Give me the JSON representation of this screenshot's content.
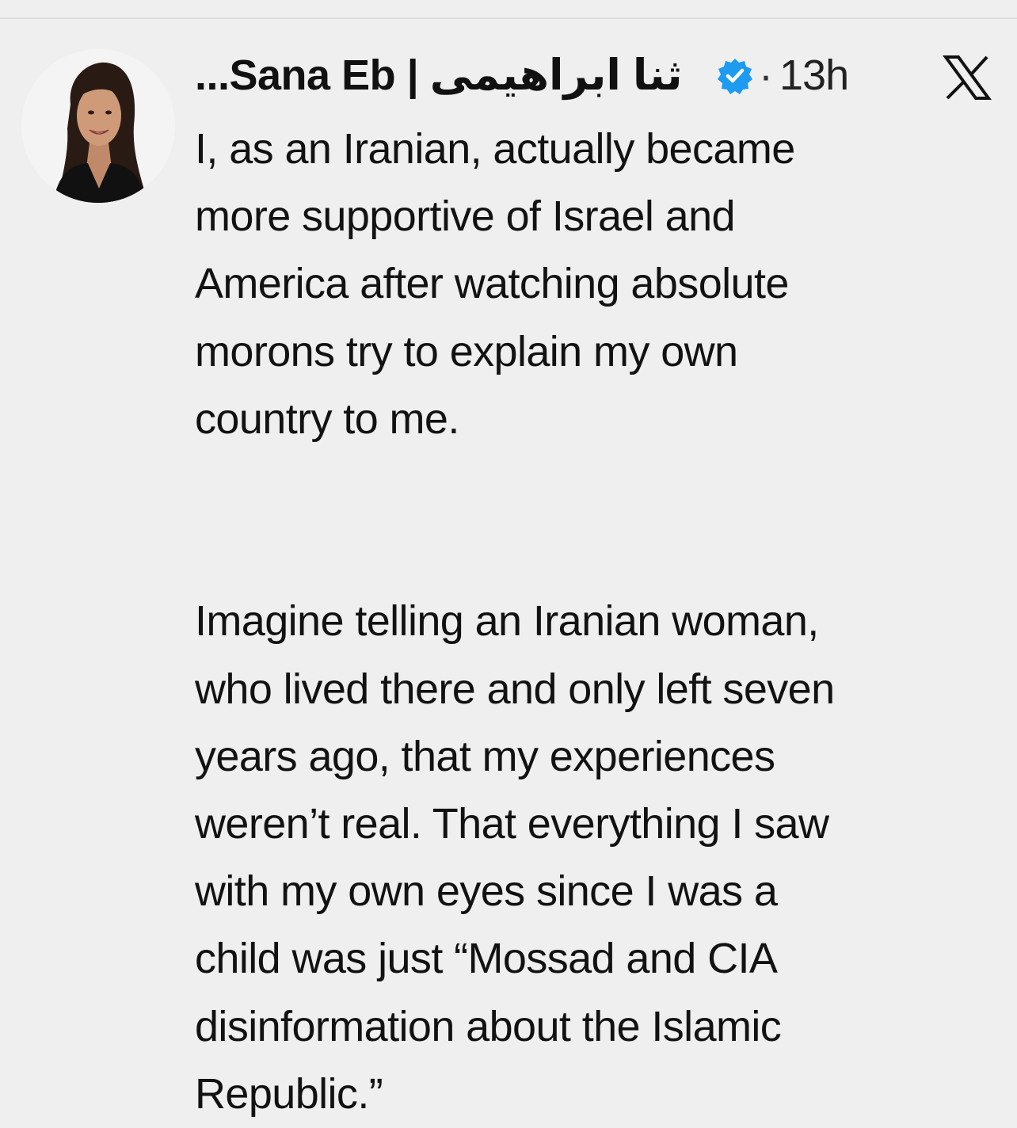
{
  "tweet": {
    "author": {
      "display_name": "...Sana Eb | ثنا ابراهیمی",
      "verified": true,
      "avatar_icon": "profile-photo"
    },
    "separator": "·",
    "timestamp": "13h",
    "platform_icon": "x-logo-icon",
    "body": {
      "paragraph_1": [
        "I, as an Iranian, actually became",
        "more supportive of Israel and",
        "America after watching absolute",
        "morons try to explain my own",
        "country to me."
      ],
      "paragraph_2": [
        "Imagine telling an Iranian woman,",
        "who lived there and only left seven",
        "years ago, that my experiences",
        "weren’t real. That everything I saw",
        "with my own eyes since I was a",
        "child was just “Mossad and CIA",
        "disinformation about the Islamic",
        "Republic.”"
      ]
    },
    "colors": {
      "background": "#efefef",
      "verified_badge": "#1d9bf0",
      "text": "#121212"
    }
  }
}
